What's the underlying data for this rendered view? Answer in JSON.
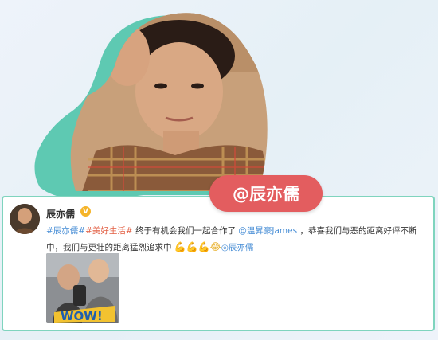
{
  "tag_label": "@辰亦儒",
  "post": {
    "username": "辰亦儒",
    "verified_mark": "V",
    "hashtag1": "#辰亦儒#",
    "hashtag2": "#美好生活#",
    "text1": "终于有机会我们一起合作了",
    "mention": "@温昇豪James",
    "text2": "，恭喜我们与恶的距离好评不断中，我们与更壮的距离猛烈追求中",
    "emojis": "💪💪💪😂",
    "mention2": "◎辰亦儒",
    "image_caption": "WOW!"
  },
  "colors": {
    "tag_bg": "#e35d5f",
    "teal": "#5ec9b2",
    "link": "#4a8fd6",
    "border": "#7fd4be"
  }
}
